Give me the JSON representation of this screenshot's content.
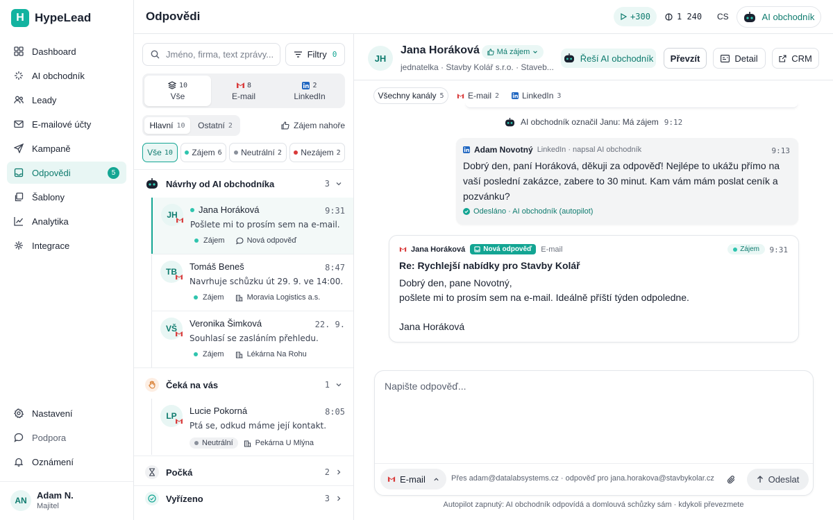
{
  "app": {
    "name": "HypeLead",
    "logo_letter": "H"
  },
  "sidebar": {
    "items": [
      {
        "label": "Dashboard",
        "icon": "grid-icon"
      },
      {
        "label": "AI obchodník",
        "icon": "sparkle-icon"
      },
      {
        "label": "Leady",
        "icon": "users-icon"
      },
      {
        "label": "E-mailové účty",
        "icon": "mail-icon"
      },
      {
        "label": "Kampaně",
        "icon": "send-icon"
      },
      {
        "label": "Odpovědi",
        "icon": "inbox-icon",
        "badge": "5"
      },
      {
        "label": "Šablony",
        "icon": "copy-icon"
      },
      {
        "label": "Analytika",
        "icon": "chart-icon"
      },
      {
        "label": "Integrace",
        "icon": "plug-icon"
      }
    ],
    "bottom": [
      {
        "label": "Nastavení",
        "icon": "gear-icon"
      },
      {
        "label": "Podpora",
        "icon": "chat-icon"
      },
      {
        "label": "Oznámení",
        "icon": "bell-icon"
      }
    ],
    "user": {
      "initials": "AN",
      "name": "Adam N.",
      "role": "Majitel"
    }
  },
  "header": {
    "title": "Odpovědi",
    "boost": "+300",
    "credits": "1 240",
    "lang": "CS",
    "ai_button": "AI obchodník"
  },
  "list": {
    "search_placeholder": "Jméno, firma, text zprávy...",
    "filters_label": "Filtry",
    "filters_count": "0",
    "channels": [
      {
        "label": "Vše",
        "count": "10"
      },
      {
        "label": "E-mail",
        "count": "8"
      },
      {
        "label": "LinkedIn",
        "count": "2"
      }
    ],
    "tabs": [
      {
        "label": "Hlavní",
        "count": "10"
      },
      {
        "label": "Ostatní",
        "count": "2"
      }
    ],
    "interest_top": "Zájem nahoře",
    "status_chips": [
      {
        "label": "Vše",
        "count": "10"
      },
      {
        "label": "Zájem",
        "count": "6"
      },
      {
        "label": "Neutrální",
        "count": "2"
      },
      {
        "label": "Nezájem",
        "count": "2"
      }
    ],
    "groups": {
      "ai": {
        "title": "Návrhy od AI obchodníka",
        "count": "3"
      },
      "waiting": {
        "title": "Čeká na vás",
        "count": "1"
      },
      "pending": {
        "title": "Počká",
        "count": "2"
      },
      "done": {
        "title": "Vyřízeno",
        "count": "3"
      }
    },
    "items": [
      {
        "initials": "JH",
        "name": "Jana Horáková",
        "time": "9:31",
        "preview": "Pošlete mi to prosím sem na e-mail.",
        "status": "Zájem",
        "meta": "Nová odpověď"
      },
      {
        "initials": "TB",
        "name": "Tomáš Beneš",
        "time": "8:47",
        "preview": "Navrhuje schůzku út 29. 9. ve 14:00.",
        "status": "Zájem",
        "meta": "Moravia Logistics a.s."
      },
      {
        "initials": "VŠ",
        "name": "Veronika Šimková",
        "time": "22. 9.",
        "preview": "Souhlasí se zasláním přehledu.",
        "status": "Zájem",
        "meta": "Lékárna Na Rohu"
      },
      {
        "initials": "LP",
        "name": "Lucie Pokorná",
        "time": "8:05",
        "preview": "Ptá se, odkud máme její kontakt.",
        "status": "Neutrální",
        "meta": "Pekárna U Mlýna"
      }
    ]
  },
  "conversation": {
    "initials": "JH",
    "name": "Jana Horáková",
    "interest": "Má zájem",
    "subtitle": "jednatelka · Stavby Kolář s.r.o. · Staveb...",
    "ai_handles": "Řeší AI obchodník",
    "takeover": "Převzít",
    "detail": "Detail",
    "crm": "CRM",
    "channels": [
      {
        "label": "Všechny kanály",
        "count": "5"
      },
      {
        "label": "E-mail",
        "count": "2"
      },
      {
        "label": "LinkedIn",
        "count": "3"
      }
    ],
    "event": {
      "text": "AI obchodník označil Janu: Má zájem",
      "time": "9:12"
    },
    "outgoing": {
      "sender": "Adam Novotný",
      "channel": "LinkedIn · napsal AI obchodník",
      "time": "9:13",
      "body": "Dobrý den, paní Horáková, děkuji za odpověď! Nejlépe to ukážu přímo na vaší poslední zakázce, zabere to 30 minut. Kam vám mám poslat ceník a pozvánku?",
      "status": "Odesláno · AI obchodník (autopilot)"
    },
    "incoming": {
      "sender": "Jana Horáková",
      "badge": "Nová odpověď",
      "channel": "E-mail",
      "status": "Zájem",
      "time": "9:31",
      "subject": "Re: Rychlejší nabídky pro Stavby Kolář",
      "line1": "Dobrý den, pane Novotný,",
      "line2": "pošlete mi to prosím sem na e-mail. Ideálně příští týden odpoledne.",
      "signature": "Jana Horáková"
    },
    "composer": {
      "placeholder": "Napište odpověď...",
      "channel": "E-mail",
      "via": "Přes adam@datalabsystems.cz · odpověď pro jana.horakova@stavbykolar.cz",
      "send": "Odeslat"
    },
    "footer": "Autopilot zapnutý: AI obchodník odpovídá a domlouvá schůzky sám · kdykoli převezmete"
  },
  "colors": {
    "accent": "#13a593",
    "accent_bg": "#e8f6f4",
    "danger": "#d93a3a",
    "neutral": "#8a909b"
  }
}
